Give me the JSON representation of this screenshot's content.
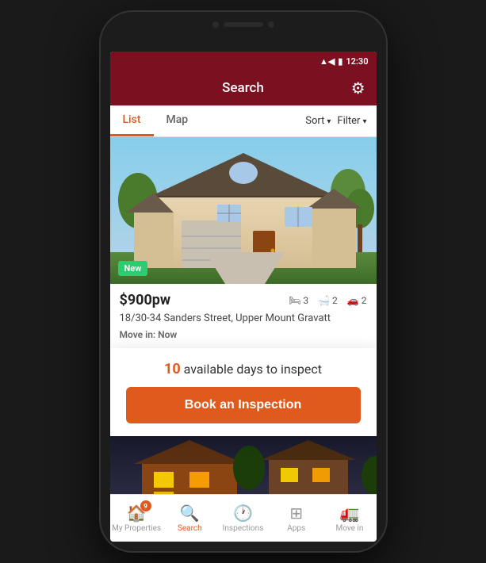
{
  "statusBar": {
    "time": "12:30",
    "signal": "▲◀",
    "battery": "🔋"
  },
  "header": {
    "title": "Search",
    "gearLabel": "⚙"
  },
  "viewTabs": {
    "list": "List",
    "map": "Map",
    "sort": "Sort",
    "filter": "Filter"
  },
  "property1": {
    "badge": "New",
    "price": "$900pw",
    "beds": "3",
    "baths": "2",
    "parking": "2",
    "address": "18/30-34 Sanders Street, Upper Mount Gravatt",
    "moveIn": "Move in: Now"
  },
  "popup": {
    "count": "10",
    "text": "  available days to inspect",
    "bookLabel": "Book an Inspection"
  },
  "bottomNav": {
    "items": [
      {
        "label": "My Properties",
        "icon": "🏠",
        "badge": "9",
        "active": false
      },
      {
        "label": "Search",
        "icon": "🔍",
        "badge": null,
        "active": true
      },
      {
        "label": "Inspections",
        "icon": "🕐",
        "badge": null,
        "active": false
      },
      {
        "label": "Apps",
        "icon": "⊞",
        "badge": null,
        "active": false
      },
      {
        "label": "Move in",
        "icon": "🚛",
        "badge": null,
        "active": false
      }
    ]
  }
}
